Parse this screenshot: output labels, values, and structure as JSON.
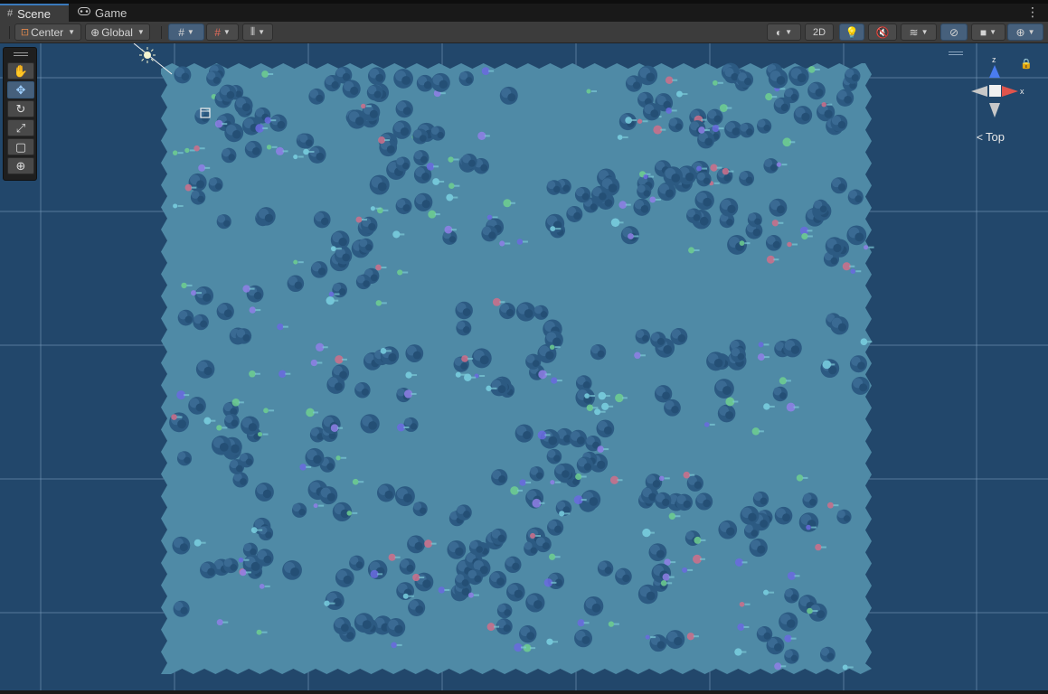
{
  "tabs": [
    {
      "label": "Scene",
      "icon": "scene-grid-icon",
      "active": true
    },
    {
      "label": "Game",
      "icon": "gamepad-icon",
      "active": false
    }
  ],
  "toolbar": {
    "pivot_mode": "Center",
    "pivot_rotation": "Global",
    "toggle_2d": "2D"
  },
  "tools": [
    "hand-tool",
    "move-tool",
    "rotate-tool",
    "scale-tool",
    "rect-tool",
    "transform-tool"
  ],
  "active_tool": "move-tool",
  "gizmo": {
    "axis_z": "z",
    "axis_x": "x",
    "view_label": "Top",
    "colors": {
      "z": "#4a7cf0",
      "x": "#e0544c",
      "neutral": "#c8c8c8"
    }
  },
  "scene": {
    "background_color": "#22476b",
    "terrain_color": "#4f8aa6",
    "rock_color": "#2c5a82",
    "grid_line_color": "#7fa3c3"
  }
}
